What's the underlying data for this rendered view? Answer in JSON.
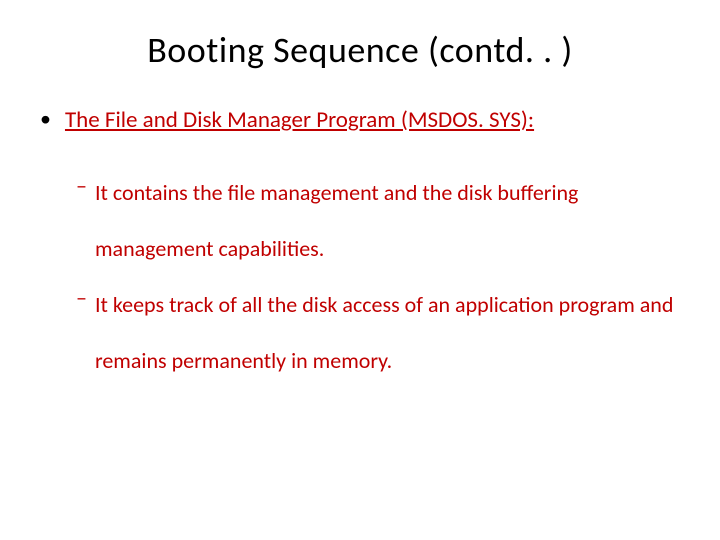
{
  "slide": {
    "title": "Booting Sequence (contd. . )",
    "level1": {
      "bullet": "•",
      "text": "The File and Disk Manager Program (MSDOS. SYS):"
    },
    "level2": [
      {
        "dash": "–",
        "text": "It contains the file management and the disk buffering management capabilities."
      },
      {
        "dash": "–",
        "text": "It keeps track of all the disk access of an application program and remains permanently in memory."
      }
    ]
  }
}
